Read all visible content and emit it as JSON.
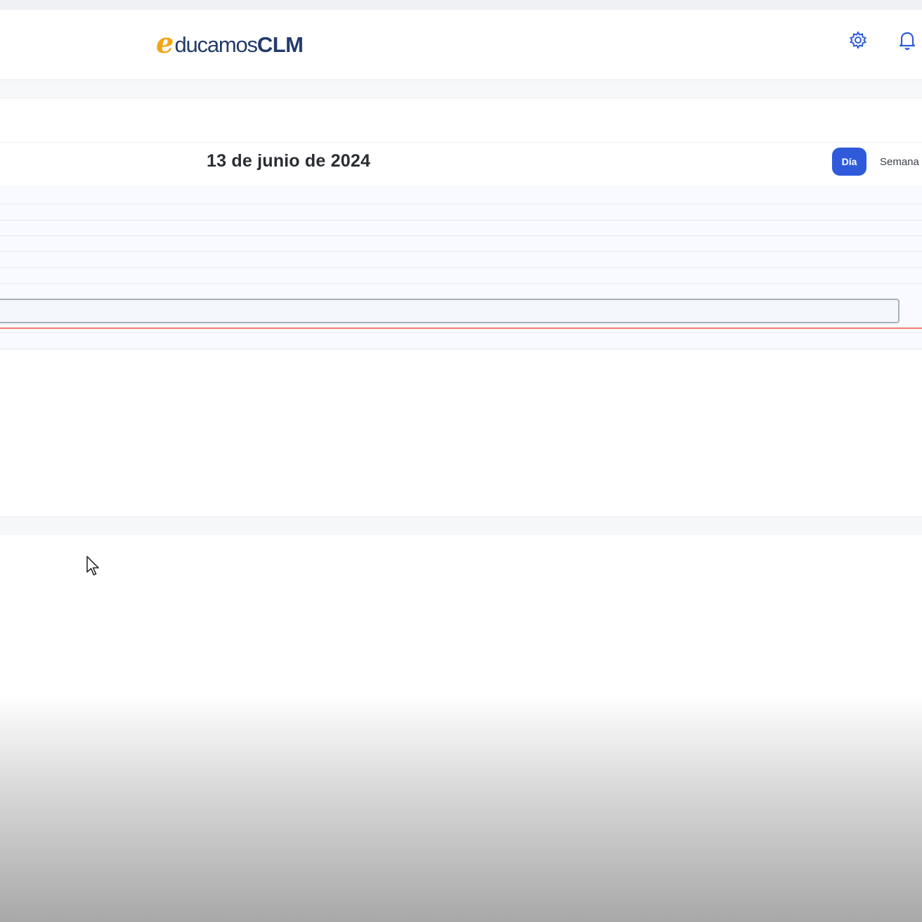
{
  "app": {
    "logo_e": "e",
    "logo_ducamos": "ducamos",
    "logo_clm": "CLM",
    "brand_colors": {
      "orange": "#f2a516",
      "navy": "#243b6b"
    }
  },
  "header": {
    "settings_icon": "gear-icon",
    "notifications_icon": "bell-icon"
  },
  "calendar": {
    "date_title": "13 de junio de 2024",
    "view_buttons": {
      "day": "Día",
      "week": "Semana"
    },
    "active_view": "day",
    "accent_color": "#2f5bdb",
    "now_indicator_color": "#ef7d6d"
  }
}
